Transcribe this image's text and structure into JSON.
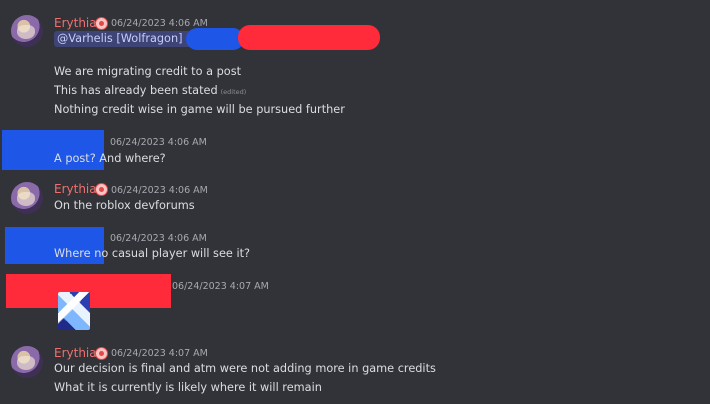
{
  "messages": [
    {
      "author": "Erythia",
      "timestamp": "06/24/2023 4:06 AM",
      "mention": "@Varhelis [Wolfragon] ✓",
      "lines": [
        "We are migrating credit to a post",
        "This has already been stated",
        "Nothing credit wise in game will be pursued further"
      ],
      "edited_label": "(edited)"
    },
    {
      "author": "",
      "timestamp": "06/24/2023 4:06 AM",
      "lines": [
        "A post? And where?"
      ]
    },
    {
      "author": "Erythia",
      "timestamp": "06/24/2023 4:06 AM",
      "lines": [
        "On the roblox devforums"
      ]
    },
    {
      "author": "",
      "timestamp": "06/24/2023 4:06 AM",
      "lines": [
        "Where no casual player will see it?"
      ]
    },
    {
      "author": "",
      "timestamp": "06/24/2023 4:07 AM",
      "sticker": "wolf-sticker"
    },
    {
      "author": "Erythia",
      "timestamp": "06/24/2023 4:07 AM",
      "lines": [
        "Our decision is final and atm were not adding more in game credits",
        "What it is currently is likely where it will remain"
      ]
    }
  ],
  "colors": {
    "background": "#313338",
    "author_name": "#f0706e",
    "redact_blue": "#1e56e8",
    "redact_red": "#ff2a3a",
    "mention_bg": "#3e4475"
  }
}
